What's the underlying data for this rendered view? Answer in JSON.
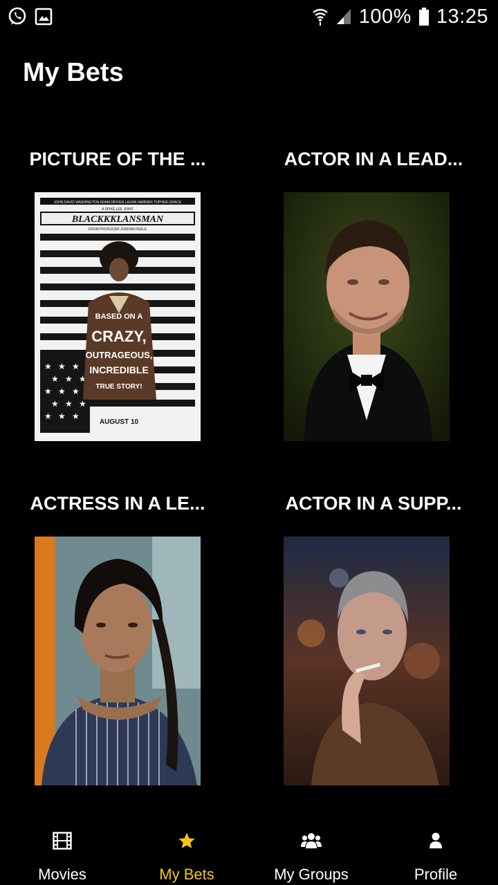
{
  "status_bar": {
    "battery": "100%",
    "time": "13:25",
    "left_icons": [
      "whatsapp-icon",
      "gallery-icon"
    ],
    "right_icons": [
      "wifi-icon",
      "signal-icon",
      "battery-icon"
    ]
  },
  "page": {
    "title": "My Bets"
  },
  "bets": [
    {
      "category": "PICTURE OF THE ...",
      "image": "blackkklansman-poster"
    },
    {
      "category": "ACTOR IN A LEAD...",
      "image": "actor-portrait"
    },
    {
      "category": "ACTRESS IN A LE...",
      "image": "actress-portrait"
    },
    {
      "category": "ACTOR IN A SUPP...",
      "image": "supporting-actor-portrait"
    }
  ],
  "poster": {
    "top_credits": "JOHN DAVID WASHINGTON   ADAM DRIVER   LAURA HARRIER   TOPHER GRACE",
    "presenter": "A SPIKE LEE JOINT",
    "title": "BLACKKKLANSMAN",
    "producer": "FROM PRODUCER JORDAN PEELE",
    "tag1": "BASED ON A",
    "tag2": "CRAZY,",
    "tag3": "OUTRAGEOUS,",
    "tag4": "INCREDIBLE",
    "tag5": "TRUE STORY!",
    "date": "AUGUST 10"
  },
  "nav": {
    "items": [
      {
        "label": "Movies",
        "icon": "film-icon",
        "active": false
      },
      {
        "label": "My Bets",
        "icon": "star-icon",
        "active": true
      },
      {
        "label": "My Groups",
        "icon": "group-icon",
        "active": false
      },
      {
        "label": "Profile",
        "icon": "person-icon",
        "active": false
      }
    ]
  },
  "colors": {
    "accent": "#f5c518",
    "background": "#000000",
    "text": "#ffffff"
  }
}
